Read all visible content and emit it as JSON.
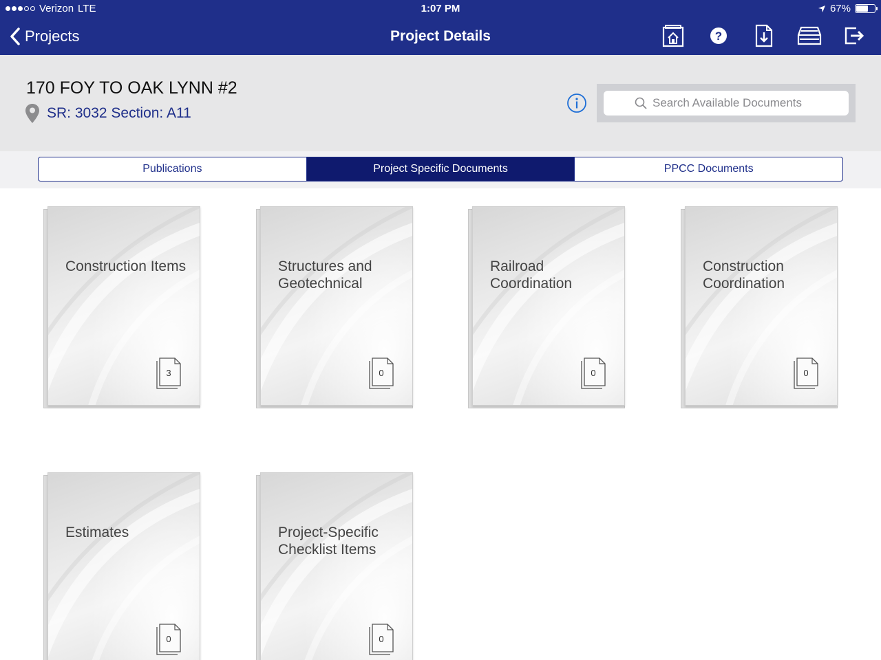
{
  "status_bar": {
    "carrier": "Verizon",
    "network": "LTE",
    "time": "1:07 PM",
    "battery_percent": "67%",
    "battery_level": 0.67,
    "signal_bars_filled": 3,
    "signal_bars_total": 5
  },
  "nav": {
    "back_label": "Projects",
    "title": "Project Details",
    "actions": [
      {
        "icon": "home-folder-icon"
      },
      {
        "icon": "help-icon"
      },
      {
        "icon": "download-document-icon"
      },
      {
        "icon": "archive-tray-icon"
      },
      {
        "icon": "logout-icon"
      }
    ]
  },
  "project": {
    "name": "170 FOY TO OAK LYNN #2",
    "location": "SR: 3032 Section: A11",
    "location_icon": "map-pin-icon",
    "info_icon": "info-icon"
  },
  "search": {
    "placeholder": "Search Available Documents",
    "icon": "search-icon"
  },
  "tabs": [
    {
      "label": "Publications",
      "active": false
    },
    {
      "label": "Project Specific Documents",
      "active": true
    },
    {
      "label": "PPCC Documents",
      "active": false
    }
  ],
  "folders": [
    {
      "label": "Construction Items",
      "count": "3"
    },
    {
      "label": "Structures and Geotechnical",
      "count": "0"
    },
    {
      "label": "Railroad Coordination",
      "count": "0"
    },
    {
      "label": "Construction Coordination",
      "count": "0"
    },
    {
      "label": "Estimates",
      "count": "0"
    },
    {
      "label": "Project-Specific Checklist Items",
      "count": "0"
    }
  ],
  "colors": {
    "header_bg": "#1f2f8a",
    "tab_active_bg": "#0f1a6e",
    "project_bar_bg": "#e7e7e8",
    "accent_blue": "#1f6fd6"
  }
}
